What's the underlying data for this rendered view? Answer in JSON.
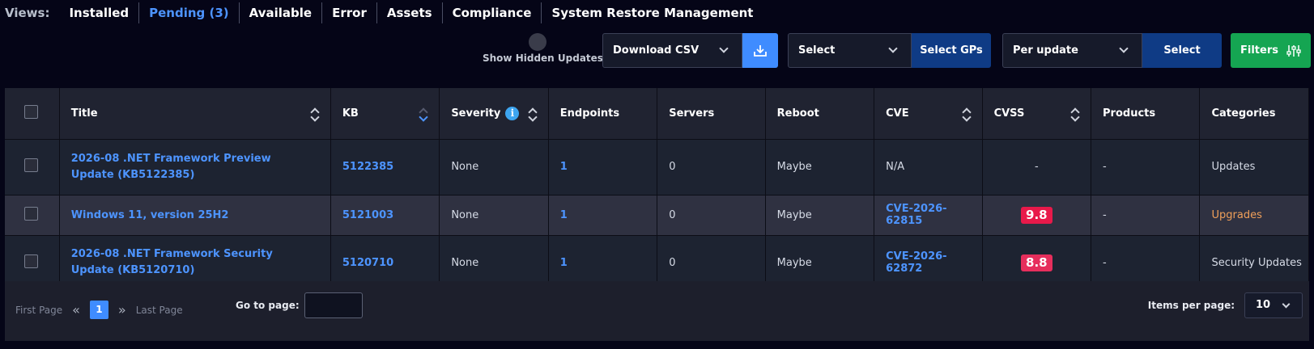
{
  "views": {
    "label": "Views:",
    "tabs": [
      {
        "label": "Installed"
      },
      {
        "label": "Pending (3)"
      },
      {
        "label": "Available"
      },
      {
        "label": "Error"
      },
      {
        "label": "Assets"
      },
      {
        "label": "Compliance"
      },
      {
        "label": "System Restore Management"
      }
    ]
  },
  "toolbar": {
    "show_hidden_label": "Show Hidden Updates",
    "download_select": "Download CSV",
    "gp_select": "Select",
    "gp_button": "Select GPs",
    "per_select": "Per update",
    "per_button": "Select",
    "filters_button": "Filters"
  },
  "table": {
    "headers": [
      "Title",
      "KB",
      "Severity",
      "Endpoints",
      "Servers",
      "Reboot",
      "CVE",
      "CVSS",
      "Products",
      "Categories"
    ],
    "rows": [
      {
        "title": "2026-08 .NET Framework Preview Update (KB5122385)",
        "kb": "5122385",
        "severity": "None",
        "endpoints": "1",
        "servers": "0",
        "reboot": "Maybe",
        "cve": "N/A",
        "cvss": "-",
        "products": "-",
        "categories": "Updates"
      },
      {
        "title": "Windows 11, version 25H2",
        "kb": "5121003",
        "severity": "None",
        "endpoints": "1",
        "servers": "0",
        "reboot": "Maybe",
        "cve": "CVE-2026-62815",
        "cvss": "9.8",
        "products": "-",
        "categories": "Upgrades"
      },
      {
        "title": "2026-08 .NET Framework Security Update (KB5120710)",
        "kb": "5120710",
        "severity": "None",
        "endpoints": "1",
        "servers": "0",
        "reboot": "Maybe",
        "cve": "CVE-2026-62872",
        "cvss": "8.8",
        "products": "-",
        "categories": "Security Updates"
      }
    ]
  },
  "colors": {
    "cvss_critical": "#e8194a",
    "cvss_high": "#e62e5c",
    "accent": "#4d94ff",
    "upgrades": "#f0a05a"
  },
  "pagination": {
    "first_label": "First Page",
    "current_page": "1",
    "last_label": "Last Page",
    "goto_label": "Go to page:",
    "items_label": "Items per page:",
    "items_value": "10"
  }
}
